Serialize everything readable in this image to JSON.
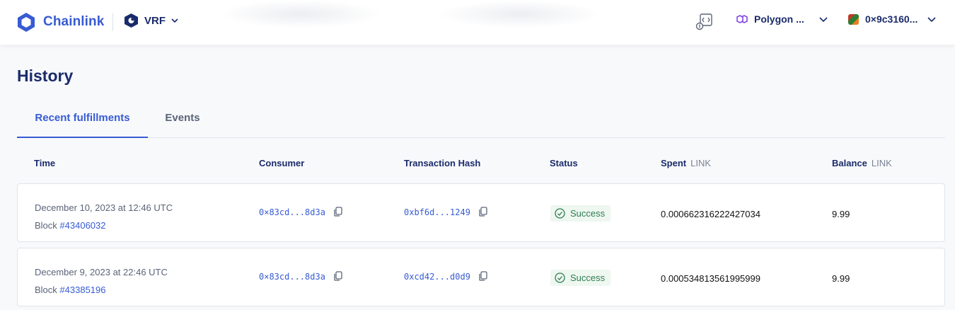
{
  "header": {
    "brand": "Chainlink",
    "product": "VRF",
    "network": "Polygon ...",
    "account": "0×9c3160..."
  },
  "page": {
    "title": "History",
    "tabs": [
      {
        "label": "Recent fulfillments",
        "active": true
      },
      {
        "label": "Events",
        "active": false
      }
    ]
  },
  "table": {
    "columns": {
      "time": "Time",
      "consumer": "Consumer",
      "tx_hash": "Transaction Hash",
      "status": "Status",
      "spent": "Spent",
      "spent_unit": "LINK",
      "balance": "Balance",
      "balance_unit": "LINK"
    },
    "rows": [
      {
        "time": "December 10, 2023 at 12:46 UTC",
        "block_prefix": "Block",
        "block": "#43406032",
        "consumer": "0×83cd...8d3a",
        "tx_hash": "0xbf6d...1249",
        "status": "Success",
        "spent": "0.000662316222427034",
        "balance": "9.99"
      },
      {
        "time": "December 9, 2023 at 22:46 UTC",
        "block_prefix": "Block",
        "block": "#43385196",
        "consumer": "0×83cd...8d3a",
        "tx_hash": "0xcd42...d0d9",
        "status": "Success",
        "spent": "0.000534813561995999",
        "balance": "9.99"
      }
    ]
  },
  "colors": {
    "accent": "#375bd2",
    "navy": "#1a2b6b",
    "success": "#2e7d4f",
    "polygon": "#8247e5"
  },
  "icons": [
    "chainlink-logo-icon",
    "vrf-icon",
    "chevron-down-icon",
    "developer-tools-icon",
    "polygon-icon",
    "avatar",
    "copy-icon",
    "check-circle-icon"
  ]
}
